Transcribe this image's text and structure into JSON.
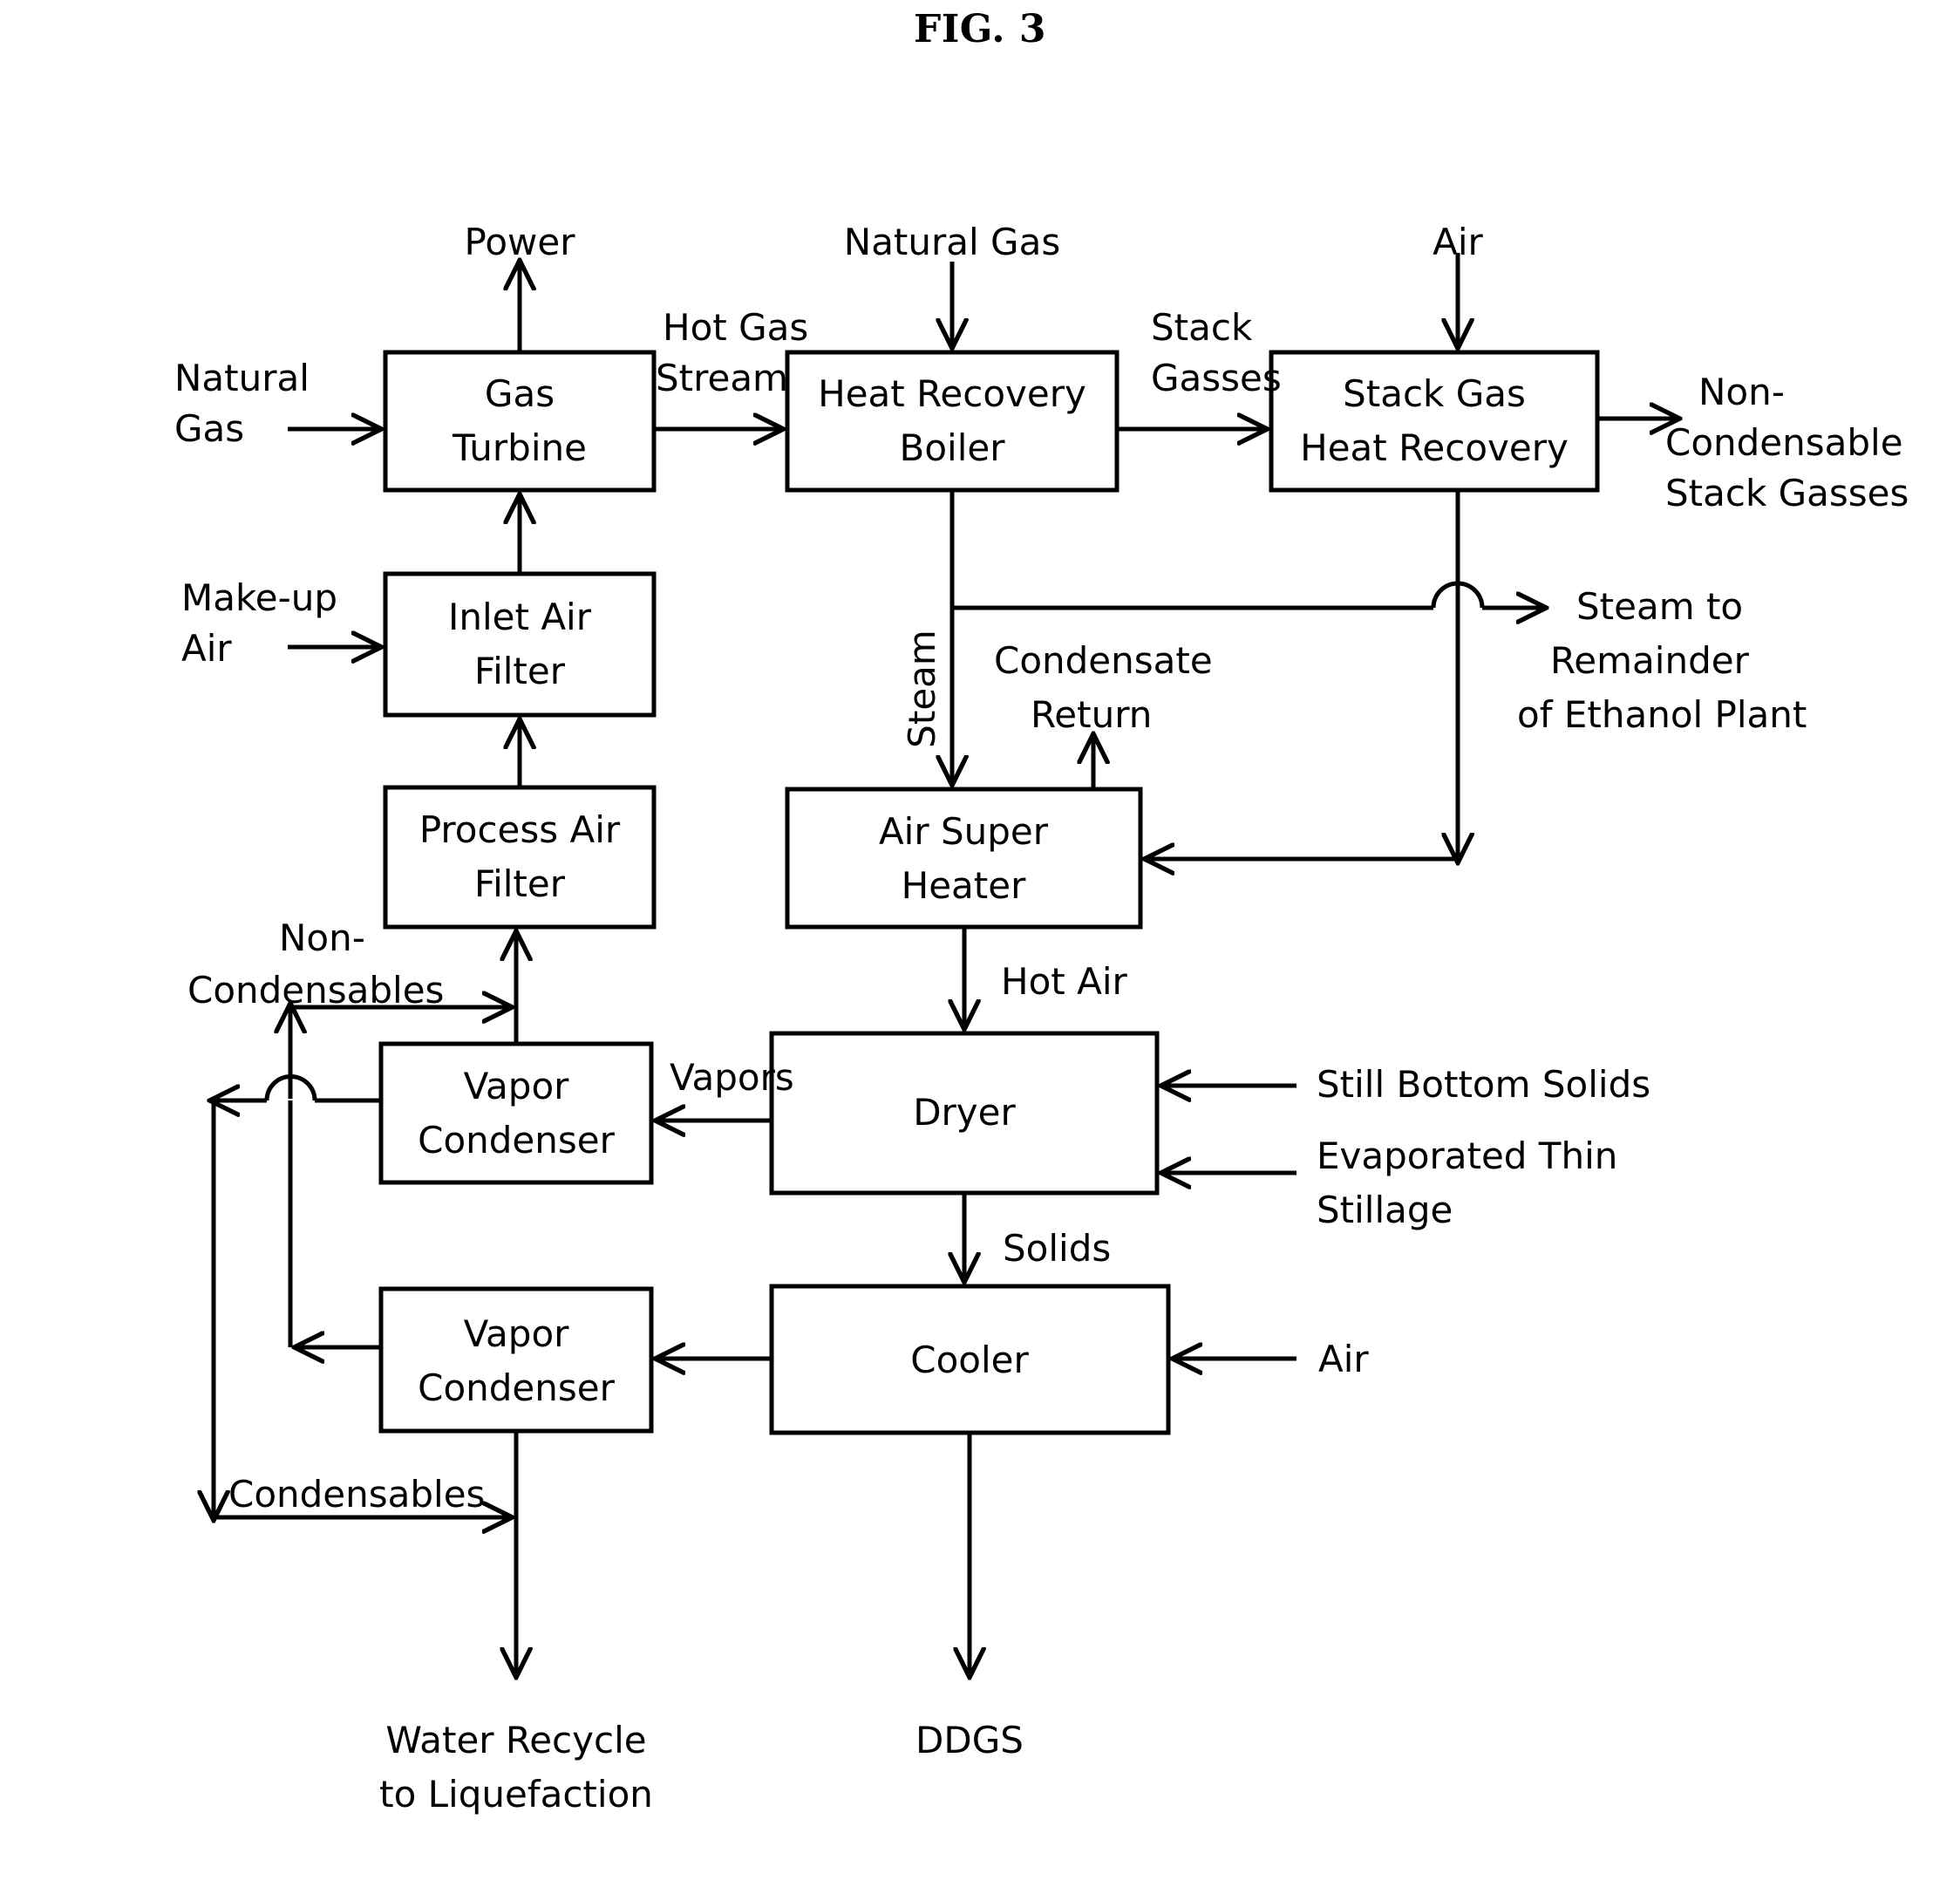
{
  "figure": {
    "title": "FIG. 3",
    "type": "process-flow-diagram",
    "subject": "Ethanol plant dryer heat integration with gas turbine cogeneration"
  },
  "boxes": {
    "gas_turbine": {
      "line1": "Gas",
      "line2": "Turbine"
    },
    "heat_recovery_boiler": {
      "line1": "Heat Recovery",
      "line2": "Boiler"
    },
    "stack_gas_heat_recovery": {
      "line1": "Stack Gas",
      "line2": "Heat Recovery"
    },
    "inlet_air_filter": {
      "line1": "Inlet Air",
      "line2": "Filter"
    },
    "process_air_filter": {
      "line1": "Process Air",
      "line2": "Filter"
    },
    "air_super_heater": {
      "line1": "Air Super",
      "line2": "Heater"
    },
    "vapor_condenser_upper": {
      "line1": "Vapor",
      "line2": "Condenser"
    },
    "vapor_condenser_lower": {
      "line1": "Vapor",
      "line2": "Condenser"
    },
    "dryer": {
      "line1": "Dryer"
    },
    "cooler": {
      "line1": "Cooler"
    }
  },
  "streams": {
    "power": "Power",
    "natural_gas_turbine_l1": "Natural",
    "natural_gas_turbine_l2": "Gas",
    "hot_gas_stream_l1": "Hot Gas",
    "hot_gas_stream_l2": "Stream",
    "natural_gas_boiler": "Natural Gas",
    "stack_gasses_l1": "Stack",
    "stack_gasses_l2": "Gasses",
    "air_stack": "Air",
    "non_condensable_stack_l1": "Non-",
    "non_condensable_stack_l2": "Condensable",
    "non_condensable_stack_l3": "Stack Gasses",
    "make_up_air_l1": "Make-up",
    "make_up_air_l2": "Air",
    "steam": "Steam",
    "condensate_return_l1": "Condensate",
    "condensate_return_l2": "Return",
    "steam_remainder_l1": "Steam to",
    "steam_remainder_l2": "Remainder",
    "steam_remainder_l3": "of Ethanol Plant",
    "hot_air": "Hot Air",
    "non_condensables_l1": "Non-",
    "non_condensables_l2": "Condensables",
    "vapors": "Vapors",
    "still_bottom_solids": "Still Bottom Solids",
    "evaporated_thin_stillage_l1": "Evaporated  Thin",
    "evaporated_thin_stillage_l2": "Stillage",
    "solids": "Solids",
    "air_cooler": "Air",
    "condensables": "Condensables",
    "water_recycle_l1": "Water Recycle",
    "water_recycle_l2": "to Liquefaction",
    "ddgs": "DDGS"
  },
  "colors": {
    "stroke": "#000000",
    "background": "#ffffff",
    "text": "#000000"
  }
}
